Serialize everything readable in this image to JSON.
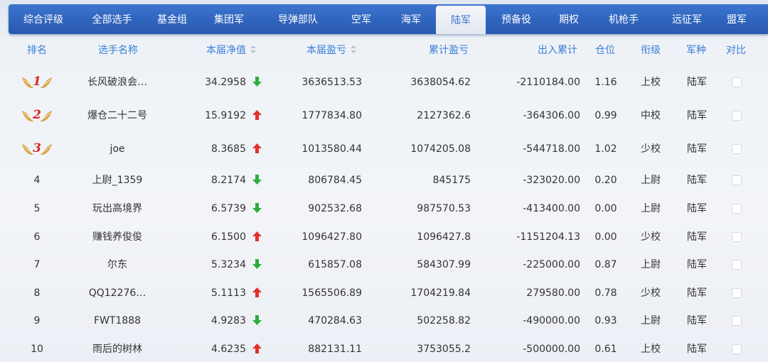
{
  "nav": {
    "tabs": [
      {
        "label": "综合评级",
        "active": false
      },
      {
        "label": "全部选手",
        "active": false
      },
      {
        "label": "基金组",
        "active": false
      },
      {
        "label": "集团军",
        "active": false
      },
      {
        "label": "导弹部队",
        "active": false
      },
      {
        "label": "空军",
        "active": false
      },
      {
        "label": "海军",
        "active": false
      },
      {
        "label": "陆军",
        "active": true
      },
      {
        "label": "预备役",
        "active": false
      },
      {
        "label": "期权",
        "active": false
      },
      {
        "label": "机枪手",
        "active": false
      },
      {
        "label": "远征军",
        "active": false
      },
      {
        "label": "盟军",
        "active": false
      }
    ]
  },
  "table": {
    "headers": {
      "rank": "排名",
      "name": "选手名称",
      "nav": "本届净值",
      "profit": "本届盈亏",
      "total_profit": "累计盈亏",
      "in_out": "出入累计",
      "position": "仓位",
      "title": "衔级",
      "army": "军种",
      "compare": "对比"
    },
    "rows": [
      {
        "rank": "1",
        "medal": true,
        "name": "长风破浪会…",
        "nav": "34.2958",
        "trend": "down",
        "profit": "3636513.53",
        "total_profit": "3638054.62",
        "in_out": "-2110184.00",
        "position": "1.16",
        "title": "上校",
        "army": "陆军"
      },
      {
        "rank": "2",
        "medal": true,
        "name": "爆仓二十二号",
        "nav": "15.9192",
        "trend": "up",
        "profit": "1777834.80",
        "total_profit": "2127362.6",
        "in_out": "-364306.00",
        "position": "0.99",
        "title": "中校",
        "army": "陆军"
      },
      {
        "rank": "3",
        "medal": true,
        "name": "joe",
        "nav": "8.3685",
        "trend": "up",
        "profit": "1013580.44",
        "total_profit": "1074205.08",
        "in_out": "-544718.00",
        "position": "1.02",
        "title": "少校",
        "army": "陆军"
      },
      {
        "rank": "4",
        "medal": false,
        "name": "上尉_1359",
        "nav": "8.2174",
        "trend": "down",
        "profit": "806784.45",
        "total_profit": "845175",
        "in_out": "-323020.00",
        "position": "0.20",
        "title": "上尉",
        "army": "陆军"
      },
      {
        "rank": "5",
        "medal": false,
        "name": "玩出高境界",
        "nav": "6.5739",
        "trend": "down",
        "profit": "902532.68",
        "total_profit": "987570.53",
        "in_out": "-413400.00",
        "position": "0.00",
        "title": "上尉",
        "army": "陆军"
      },
      {
        "rank": "6",
        "medal": false,
        "name": "赚钱养俊俊",
        "nav": "6.1500",
        "trend": "up",
        "profit": "1096427.80",
        "total_profit": "1096427.8",
        "in_out": "-1151204.13",
        "position": "0.00",
        "title": "少校",
        "army": "陆军"
      },
      {
        "rank": "7",
        "medal": false,
        "name": "尔东",
        "nav": "5.3234",
        "trend": "down",
        "profit": "615857.08",
        "total_profit": "584307.99",
        "in_out": "-225000.00",
        "position": "0.87",
        "title": "上尉",
        "army": "陆军"
      },
      {
        "rank": "8",
        "medal": false,
        "name": "QQ12276…",
        "nav": "5.1113",
        "trend": "up",
        "profit": "1565506.89",
        "total_profit": "1704219.84",
        "in_out": "279580.00",
        "position": "0.78",
        "title": "少校",
        "army": "陆军"
      },
      {
        "rank": "9",
        "medal": false,
        "name": "FWT1888",
        "nav": "4.9283",
        "trend": "down",
        "profit": "470284.63",
        "total_profit": "502258.82",
        "in_out": "-490000.00",
        "position": "0.93",
        "title": "上尉",
        "army": "陆军"
      },
      {
        "rank": "10",
        "medal": false,
        "name": "雨后的树林",
        "nav": "4.6235",
        "trend": "up",
        "profit": "882131.11",
        "total_profit": "3753055.2",
        "in_out": "-500000.00",
        "position": "0.61",
        "title": "上校",
        "army": "陆军"
      }
    ]
  },
  "colors": {
    "nav_bg": "#2f64bd",
    "header_text": "#3a7fd6",
    "up_arrow": "#e0322b",
    "down_arrow": "#2eae3a",
    "medal_gold": "#d9a441",
    "medal_number": "#d8281f"
  }
}
